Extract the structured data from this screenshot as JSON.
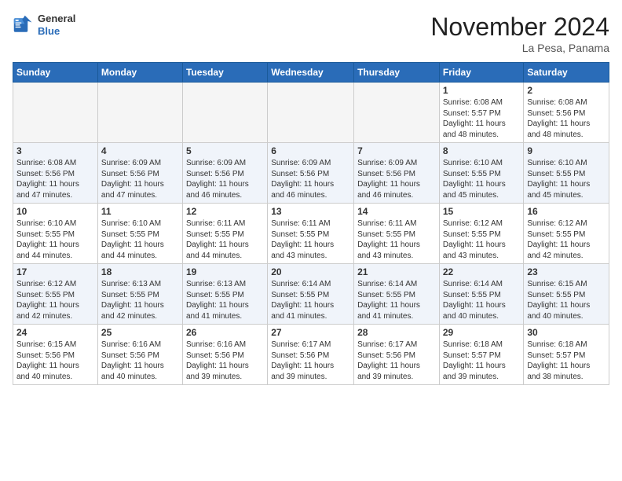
{
  "header": {
    "logo_line1": "General",
    "logo_line2": "Blue",
    "month": "November 2024",
    "location": "La Pesa, Panama"
  },
  "weekdays": [
    "Sunday",
    "Monday",
    "Tuesday",
    "Wednesday",
    "Thursday",
    "Friday",
    "Saturday"
  ],
  "weeks": [
    [
      {
        "day": "",
        "info": ""
      },
      {
        "day": "",
        "info": ""
      },
      {
        "day": "",
        "info": ""
      },
      {
        "day": "",
        "info": ""
      },
      {
        "day": "",
        "info": ""
      },
      {
        "day": "1",
        "info": "Sunrise: 6:08 AM\nSunset: 5:57 PM\nDaylight: 11 hours\nand 48 minutes."
      },
      {
        "day": "2",
        "info": "Sunrise: 6:08 AM\nSunset: 5:56 PM\nDaylight: 11 hours\nand 48 minutes."
      }
    ],
    [
      {
        "day": "3",
        "info": "Sunrise: 6:08 AM\nSunset: 5:56 PM\nDaylight: 11 hours\nand 47 minutes."
      },
      {
        "day": "4",
        "info": "Sunrise: 6:09 AM\nSunset: 5:56 PM\nDaylight: 11 hours\nand 47 minutes."
      },
      {
        "day": "5",
        "info": "Sunrise: 6:09 AM\nSunset: 5:56 PM\nDaylight: 11 hours\nand 46 minutes."
      },
      {
        "day": "6",
        "info": "Sunrise: 6:09 AM\nSunset: 5:56 PM\nDaylight: 11 hours\nand 46 minutes."
      },
      {
        "day": "7",
        "info": "Sunrise: 6:09 AM\nSunset: 5:56 PM\nDaylight: 11 hours\nand 46 minutes."
      },
      {
        "day": "8",
        "info": "Sunrise: 6:10 AM\nSunset: 5:55 PM\nDaylight: 11 hours\nand 45 minutes."
      },
      {
        "day": "9",
        "info": "Sunrise: 6:10 AM\nSunset: 5:55 PM\nDaylight: 11 hours\nand 45 minutes."
      }
    ],
    [
      {
        "day": "10",
        "info": "Sunrise: 6:10 AM\nSunset: 5:55 PM\nDaylight: 11 hours\nand 44 minutes."
      },
      {
        "day": "11",
        "info": "Sunrise: 6:10 AM\nSunset: 5:55 PM\nDaylight: 11 hours\nand 44 minutes."
      },
      {
        "day": "12",
        "info": "Sunrise: 6:11 AM\nSunset: 5:55 PM\nDaylight: 11 hours\nand 44 minutes."
      },
      {
        "day": "13",
        "info": "Sunrise: 6:11 AM\nSunset: 5:55 PM\nDaylight: 11 hours\nand 43 minutes."
      },
      {
        "day": "14",
        "info": "Sunrise: 6:11 AM\nSunset: 5:55 PM\nDaylight: 11 hours\nand 43 minutes."
      },
      {
        "day": "15",
        "info": "Sunrise: 6:12 AM\nSunset: 5:55 PM\nDaylight: 11 hours\nand 43 minutes."
      },
      {
        "day": "16",
        "info": "Sunrise: 6:12 AM\nSunset: 5:55 PM\nDaylight: 11 hours\nand 42 minutes."
      }
    ],
    [
      {
        "day": "17",
        "info": "Sunrise: 6:12 AM\nSunset: 5:55 PM\nDaylight: 11 hours\nand 42 minutes."
      },
      {
        "day": "18",
        "info": "Sunrise: 6:13 AM\nSunset: 5:55 PM\nDaylight: 11 hours\nand 42 minutes."
      },
      {
        "day": "19",
        "info": "Sunrise: 6:13 AM\nSunset: 5:55 PM\nDaylight: 11 hours\nand 41 minutes."
      },
      {
        "day": "20",
        "info": "Sunrise: 6:14 AM\nSunset: 5:55 PM\nDaylight: 11 hours\nand 41 minutes."
      },
      {
        "day": "21",
        "info": "Sunrise: 6:14 AM\nSunset: 5:55 PM\nDaylight: 11 hours\nand 41 minutes."
      },
      {
        "day": "22",
        "info": "Sunrise: 6:14 AM\nSunset: 5:55 PM\nDaylight: 11 hours\nand 40 minutes."
      },
      {
        "day": "23",
        "info": "Sunrise: 6:15 AM\nSunset: 5:55 PM\nDaylight: 11 hours\nand 40 minutes."
      }
    ],
    [
      {
        "day": "24",
        "info": "Sunrise: 6:15 AM\nSunset: 5:56 PM\nDaylight: 11 hours\nand 40 minutes."
      },
      {
        "day": "25",
        "info": "Sunrise: 6:16 AM\nSunset: 5:56 PM\nDaylight: 11 hours\nand 40 minutes."
      },
      {
        "day": "26",
        "info": "Sunrise: 6:16 AM\nSunset: 5:56 PM\nDaylight: 11 hours\nand 39 minutes."
      },
      {
        "day": "27",
        "info": "Sunrise: 6:17 AM\nSunset: 5:56 PM\nDaylight: 11 hours\nand 39 minutes."
      },
      {
        "day": "28",
        "info": "Sunrise: 6:17 AM\nSunset: 5:56 PM\nDaylight: 11 hours\nand 39 minutes."
      },
      {
        "day": "29",
        "info": "Sunrise: 6:18 AM\nSunset: 5:57 PM\nDaylight: 11 hours\nand 39 minutes."
      },
      {
        "day": "30",
        "info": "Sunrise: 6:18 AM\nSunset: 5:57 PM\nDaylight: 11 hours\nand 38 minutes."
      }
    ]
  ]
}
